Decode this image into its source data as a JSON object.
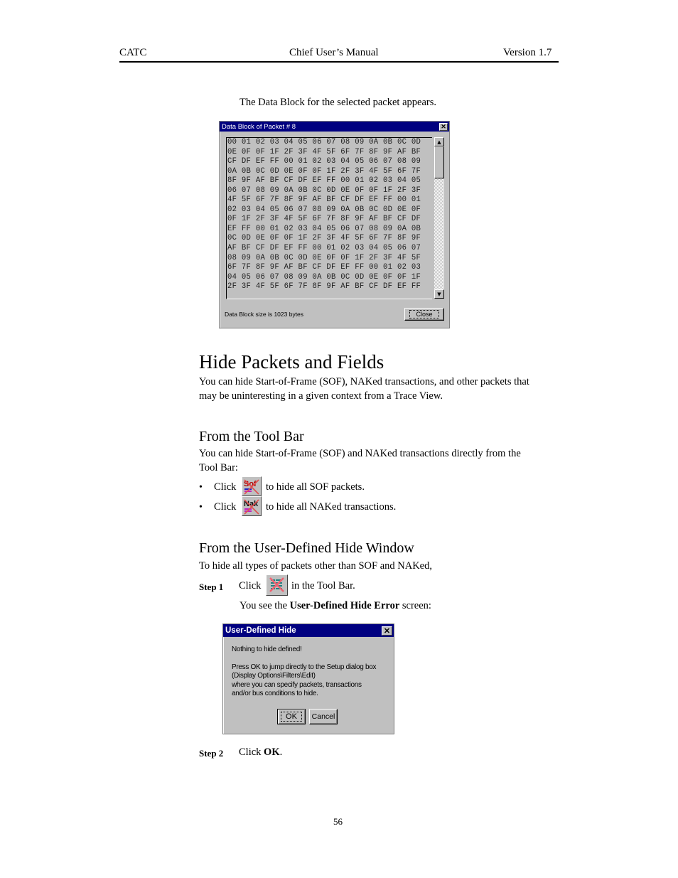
{
  "header": {
    "left": "CATC",
    "center": "Chief User’s Manual",
    "right": "Version 1.7"
  },
  "intro_text": "The Data Block for the selected packet appears.",
  "data_block_dialog": {
    "title": "Data Block of Packet # 8",
    "close_x": "✕",
    "hex_rows": [
      "00 01 02 03 04 05 06 07 08 09 0A 0B 0C 0D",
      "0E 0F 0F 1F 2F 3F 4F 5F 6F 7F 8F 9F AF BF",
      "CF DF EF FF 00 01 02 03 04 05 06 07 08 09",
      "0A 0B 0C 0D 0E 0F 0F 1F 2F 3F 4F 5F 6F 7F",
      "8F 9F AF BF CF DF EF FF 00 01 02 03 04 05",
      "06 07 08 09 0A 0B 0C 0D 0E 0F 0F 1F 2F 3F",
      "4F 5F 6F 7F 8F 9F AF BF CF DF EF FF 00 01",
      "02 03 04 05 06 07 08 09 0A 0B 0C 0D 0E 0F",
      "0F 1F 2F 3F 4F 5F 6F 7F 8F 9F AF BF CF DF",
      "EF FF 00 01 02 03 04 05 06 07 08 09 0A 0B",
      "0C 0D 0E 0F 0F 1F 2F 3F 4F 5F 6F 7F 8F 9F",
      "AF BF CF DF EF FF 00 01 02 03 04 05 06 07",
      "08 09 0A 0B 0C 0D 0E 0F 0F 1F 2F 3F 4F 5F",
      "6F 7F 8F 9F AF BF CF DF EF FF 00 01 02 03",
      "04 05 06 07 08 09 0A 0B 0C 0D 0E 0F 0F 1F",
      "2F 3F 4F 5F 6F 7F 8F 9F AF BF CF DF EF FF"
    ],
    "scroll_up": "▲",
    "scroll_down": "▼",
    "status": "Data Block size is 1023 bytes",
    "close_button": "Close"
  },
  "section": {
    "title": "Hide Packets and Fields",
    "body_lines": [
      "You can hide Start-of-Frame (SOF), NAKed transactions, and other packets that",
      "may be uninteresting in a given context from a Trace View."
    ]
  },
  "toolbar_section": {
    "title": "From the Tool Bar",
    "body_lines": [
      "You can hide Start-of-Frame (SOF) and NAKed transactions directly from the",
      "Tool Bar:"
    ],
    "bullets": [
      {
        "bullet": "•",
        "prefix": "Click",
        "icon": "hide-sof-icon",
        "icon_text": "Sof",
        "suffix": "to hide all SOF packets."
      },
      {
        "bullet": "•",
        "prefix": "Click",
        "icon": "hide-nak-icon",
        "icon_text": "Nak",
        "suffix": "to hide all NAKed transactions."
      }
    ]
  },
  "user_hide_section": {
    "title": "From the User-Defined Hide Window",
    "intro": "To hide all types of packets other than SOF and NAKed,",
    "step1": {
      "label": "Step 1",
      "prefix": "Click",
      "icon": "user-defined-hide-icon",
      "suffix": "in the Tool Bar.",
      "note_prefix": "You see the ",
      "note_bold": "User-Defined Hide Error",
      "note_suffix": " screen:"
    },
    "step2": {
      "label": "Step 2",
      "prefix": "Click ",
      "bold": "OK",
      "suffix": "."
    }
  },
  "user_hide_dialog": {
    "title": "User-Defined Hide",
    "close_x": "✕",
    "line1": "Nothing to hide defined!",
    "lines": [
      "Press OK to jump directly to the Setup dialog box",
      "(Display Options\\Filters\\Edit)",
      "where you can specify packets, transactions",
      "and/or bus conditions to hide."
    ],
    "ok_button": "OK",
    "cancel_button": "Cancel"
  },
  "footer": {
    "page_number": "56"
  }
}
